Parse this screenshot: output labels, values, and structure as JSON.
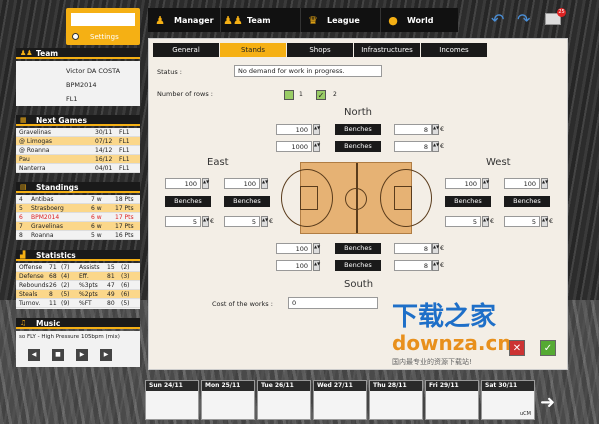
{
  "settings": {
    "label": "Settings"
  },
  "nav": [
    {
      "label": "Manager",
      "icon": "person-icon"
    },
    {
      "label": "Team",
      "icon": "group-icon"
    },
    {
      "label": "League",
      "icon": "trophy-icon"
    },
    {
      "label": "World",
      "icon": "globe-icon"
    }
  ],
  "topicons": {
    "mail_badge": "25"
  },
  "team": {
    "title": "Team",
    "name": "Victor DA COSTA",
    "club": "BPM2014",
    "league": "FL1"
  },
  "next_games": {
    "title": "Next Games",
    "rows": [
      [
        "Gravelinas",
        "30/11",
        "FL1"
      ],
      [
        "@ Limogas",
        "07/12",
        "FL1"
      ],
      [
        "@ Roanna",
        "14/12",
        "FL1"
      ],
      [
        "Pau",
        "16/12",
        "FL1"
      ],
      [
        "Nanterra",
        "04/01",
        "FL1"
      ]
    ]
  },
  "standings": {
    "title": "Standings",
    "rows": [
      [
        "4",
        "Antibas",
        "7 w",
        "18 Pts"
      ],
      [
        "5",
        "Strasboerg",
        "6 w",
        "17 Pts"
      ],
      [
        "6",
        "BPM2014",
        "6 w",
        "17 Pts"
      ],
      [
        "7",
        "Gravelinas",
        "6 w",
        "17 Pts"
      ],
      [
        "8",
        "Roanna",
        "5 w",
        "16 Pts"
      ]
    ]
  },
  "statistics": {
    "title": "Statistics",
    "rows": [
      [
        "Offense",
        "71",
        "(7)",
        "Assists",
        "15",
        "(2)"
      ],
      [
        "Defense",
        "68",
        "(4)",
        "Eff.",
        "81",
        "(3)"
      ],
      [
        "Rebounds",
        "26",
        "(2)",
        "%3pts",
        "47",
        "(6)"
      ],
      [
        "Steals",
        "8",
        "(5)",
        "%2pts",
        "49",
        "(6)"
      ],
      [
        "Turnov.",
        "11",
        "(9)",
        "%FT",
        "80",
        "(5)"
      ]
    ]
  },
  "music": {
    "title": "Music",
    "track": "so FLY - High Pressure 105bpm (mix)"
  },
  "tabs": [
    "General",
    "Stands",
    "Shops",
    "Infrastructures",
    "Incomes"
  ],
  "status": {
    "label": "Status :",
    "value": "No demand for work in progress."
  },
  "rows": {
    "label": "Number of rows :",
    "opt1": "1",
    "opt2": "2"
  },
  "north": {
    "title": "North",
    "r1_val": "100",
    "r1_type": "Benches",
    "r1_price": "8",
    "r2_val": "1000",
    "r2_type": "Benches",
    "r2_price": "8"
  },
  "south": {
    "title": "South",
    "r1_val": "100",
    "r1_type": "Benches",
    "r1_price": "8",
    "r2_val": "100",
    "r2_type": "Benches",
    "r2_price": "8"
  },
  "east": {
    "title": "East",
    "a_val": "100",
    "b_val": "100",
    "a_type": "Benches",
    "b_type": "Benches",
    "a_price": "5",
    "b_price": "5"
  },
  "west": {
    "title": "West",
    "a_val": "100",
    "b_val": "100",
    "a_type": "Benches",
    "b_type": "Benches",
    "a_price": "5",
    "b_price": "5"
  },
  "euro": "€",
  "cost": {
    "label": "Cost of the works :",
    "value": "0"
  },
  "days": [
    {
      "d": "Sun 24/11",
      "e": ""
    },
    {
      "d": "Mon 25/11",
      "e": ""
    },
    {
      "d": "Tue 26/11",
      "e": ""
    },
    {
      "d": "Wed 27/11",
      "e": ""
    },
    {
      "d": "Thu 28/11",
      "e": ""
    },
    {
      "d": "Fri 29/11",
      "e": ""
    },
    {
      "d": "Sat 30/11",
      "e": "uCM"
    }
  ],
  "watermark": {
    "cn": "下载之家",
    "en": "downza.cn",
    "sub": "国内最专业的资源下载站!"
  }
}
